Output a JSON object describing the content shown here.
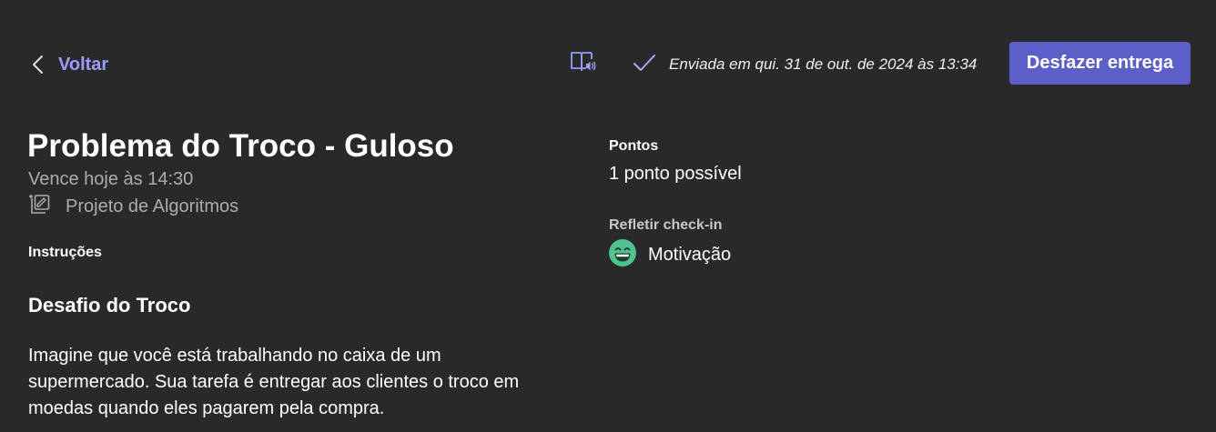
{
  "header": {
    "back_label": "Voltar",
    "back_icon": "chevron-left-icon",
    "reader_icon": "immersive-reader-icon",
    "status_icon": "checkmark-icon",
    "status_text": "Enviada em qui. 31 de out. de 2024 às 13:34",
    "undo_label": "Desfazer entrega",
    "accent_color": "#5b5fc7",
    "link_color": "#9a9dfc"
  },
  "assignment": {
    "title": "Problema do Troco - Guloso",
    "due": "Vence hoje às 14:30",
    "category_icon": "assignment-category-icon",
    "category": "Projeto de Algoritmos",
    "instructions_heading": "Instruções",
    "section_heading": "Desafio do Troco",
    "body_lines": [
      "Imagine que você está trabalhando no caixa de um",
      "supermercado. Sua tarefa é entregar aos clientes o troco em",
      "moedas quando eles pagarem pela compra."
    ]
  },
  "sidebar": {
    "points_label": "Pontos",
    "points_value": "1 ponto possível",
    "reflect_label": "Refletir check-in",
    "reflect_icon": "grinning-face-emoji-icon",
    "reflect_value": "Motivação"
  }
}
